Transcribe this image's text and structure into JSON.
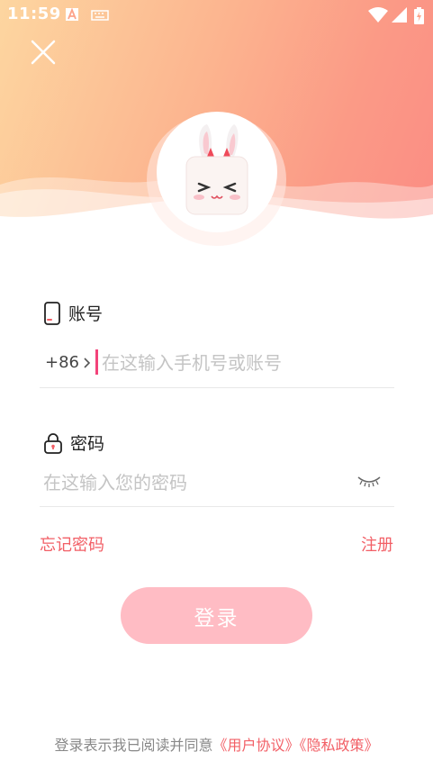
{
  "status_bar": {
    "time": "11:59"
  },
  "colors": {
    "accent": "#f25f66",
    "caret": "#f3437a",
    "login_button": "#ffbcc4"
  },
  "icons": [
    "close-icon",
    "rabbit-avatar",
    "phone-icon",
    "lock-icon",
    "eye-closed-icon",
    "chevron-right-icon"
  ],
  "account": {
    "label": "账号",
    "prefix": "+86",
    "placeholder": "在这输入手机号或账号"
  },
  "password": {
    "label": "密码",
    "placeholder": "在这输入您的密码"
  },
  "links": {
    "forgot": "忘记密码",
    "register": "注册"
  },
  "login_button": "登录",
  "agreement": {
    "text": "登录表示我已阅读并同意",
    "user_agreement": "《用户协议》",
    "privacy_policy": "《隐私政策》"
  }
}
